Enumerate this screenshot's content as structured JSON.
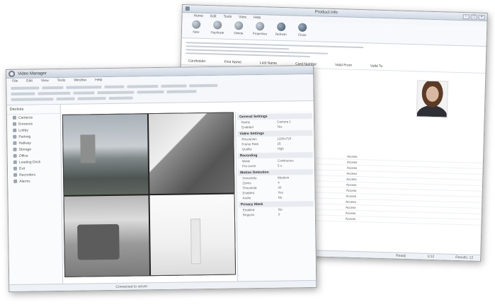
{
  "back_window": {
    "title": "Product info",
    "ribbon_tabs": [
      "Home",
      "Edit",
      "Tools",
      "View",
      "Help"
    ],
    "ribbon_buttons": [
      "New",
      "Duplicate",
      "Delete",
      "Properties",
      "Refresh",
      "Close"
    ],
    "header_cols": [
      "Cardholder",
      "First Name",
      "Last Name",
      "Card Number",
      "Valid From",
      "Valid To"
    ],
    "list_rows": [
      [
        "Workstation",
        "Access"
      ],
      [
        "Workstation",
        "Access"
      ],
      [
        "Workstation",
        "Access"
      ],
      [
        "Workstation",
        "Access"
      ],
      [
        "Workstation",
        "Access"
      ],
      [
        "Workstation",
        "Access"
      ],
      [
        "Workstation",
        "Access"
      ],
      [
        "Workstation",
        "Access"
      ],
      [
        "Workstation",
        "Access"
      ],
      [
        "Workstation",
        "Access"
      ],
      [
        "Workstation",
        "Access"
      ],
      [
        "Workstation",
        "Access"
      ]
    ],
    "status": [
      "Ready",
      "1/12",
      "Results: 12"
    ]
  },
  "front_window": {
    "title": "Video Manager",
    "menu": [
      "File",
      "Edit",
      "View",
      "Tools",
      "Window",
      "Help"
    ],
    "nav_title": "Devices",
    "nav_items": [
      "Cameras",
      "Entrance",
      "Lobby",
      "Parking",
      "Hallway",
      "Storage",
      "Office",
      "Loading Dock",
      "Exit",
      "Recorders",
      "Alarms"
    ],
    "prop_sections": [
      {
        "title": "General Settings",
        "rows": [
          [
            "Name",
            "Camera 1"
          ],
          [
            "Enabled",
            "Yes"
          ]
        ]
      },
      {
        "title": "Video Settings",
        "rows": [
          [
            "Resolution",
            "1280x720"
          ],
          [
            "Frame Rate",
            "25"
          ],
          [
            "Quality",
            "High"
          ]
        ]
      },
      {
        "title": "Recording",
        "rows": [
          [
            "Mode",
            "Continuous"
          ],
          [
            "Pre-event",
            "5 s"
          ]
        ]
      },
      {
        "title": "Motion Detection",
        "rows": [
          [
            "Sensitivity",
            "Medium"
          ],
          [
            "Zones",
            "4"
          ],
          [
            "Threshold",
            "30"
          ],
          [
            "Enabled",
            "Yes"
          ],
          [
            "Audio",
            "No"
          ]
        ]
      },
      {
        "title": "Privacy Mask",
        "rows": [
          [
            "Enabled",
            "No"
          ],
          [
            "Regions",
            "0"
          ]
        ]
      }
    ],
    "status": "Connected to server"
  }
}
